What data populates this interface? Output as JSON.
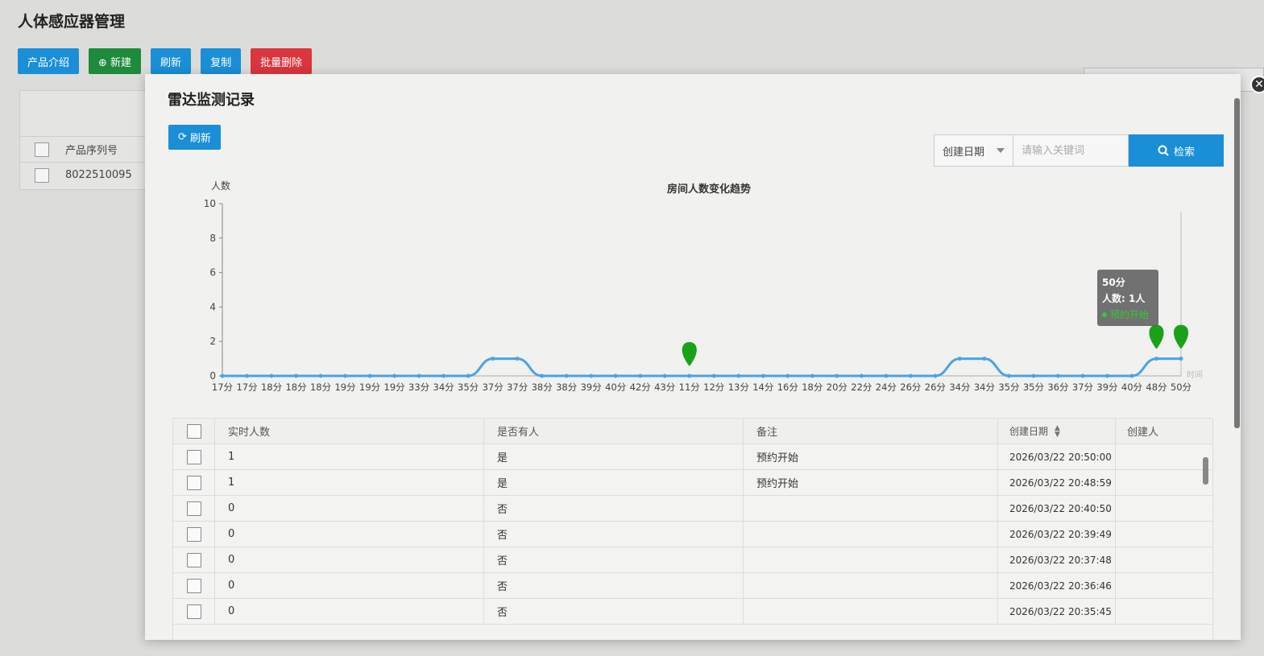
{
  "background": {
    "page_title": "人体感应器管理",
    "toolbar": [
      "产品介绍",
      "⊕ 新建",
      "刷新",
      "复制",
      "批量删除"
    ],
    "table_header": "产品序列号",
    "table_row": "8022510095"
  },
  "modal": {
    "title": "雷达监测记录",
    "close_label": "✕",
    "refresh_label": "刷新",
    "search": {
      "date_label": "创建日期",
      "placeholder": "请输入关键词",
      "button_label": "检索"
    }
  },
  "chart_data": {
    "type": "line",
    "title": "房间人数变化趋势",
    "ylabel": "人数",
    "xlabel": "时间",
    "ylim": [
      0,
      10
    ],
    "yticks": [
      0,
      2,
      4,
      6,
      8,
      10
    ],
    "categories": [
      "17分",
      "17分",
      "18分",
      "18分",
      "18分",
      "19分",
      "19分",
      "19分",
      "33分",
      "34分",
      "35分",
      "37分",
      "37分",
      "38分",
      "38分",
      "39分",
      "40分",
      "42分",
      "43分",
      "11分",
      "12分",
      "13分",
      "14分",
      "16分",
      "18分",
      "20分",
      "22分",
      "24分",
      "26分",
      "26分",
      "34分",
      "34分",
      "35分",
      "35分",
      "36分",
      "37分",
      "39分",
      "40分",
      "48分",
      "50分"
    ],
    "values": [
      0,
      0,
      0,
      0,
      0,
      0,
      0,
      0,
      0,
      0,
      0,
      1,
      1,
      0,
      0,
      0,
      0,
      0,
      0,
      0,
      0,
      0,
      0,
      0,
      0,
      0,
      0,
      0,
      0,
      0,
      1,
      1,
      0,
      0,
      0,
      0,
      0,
      0,
      1,
      1
    ],
    "markers": [
      19,
      38,
      39
    ],
    "tooltip": {
      "time": "50分",
      "line": "人数: 1人",
      "note": "预约开始"
    },
    "colors": {
      "line": "#4aa3e8",
      "marker": "#1aa11a"
    }
  },
  "table": {
    "headers": {
      "count": "实时人数",
      "has_person": "是否有人",
      "note": "备注",
      "date": "创建日期",
      "creator": "创建人"
    },
    "rows": [
      {
        "count": "1",
        "has_person": "是",
        "note": "预约开始",
        "date": "2026/03/22 20:50:00",
        "creator": ""
      },
      {
        "count": "1",
        "has_person": "是",
        "note": "预约开始",
        "date": "2026/03/22 20:48:59",
        "creator": ""
      },
      {
        "count": "0",
        "has_person": "否",
        "note": "",
        "date": "2026/03/22 20:40:50",
        "creator": ""
      },
      {
        "count": "0",
        "has_person": "否",
        "note": "",
        "date": "2026/03/22 20:39:49",
        "creator": ""
      },
      {
        "count": "0",
        "has_person": "否",
        "note": "",
        "date": "2026/03/22 20:37:48",
        "creator": ""
      },
      {
        "count": "0",
        "has_person": "否",
        "note": "",
        "date": "2026/03/22 20:36:46",
        "creator": ""
      },
      {
        "count": "0",
        "has_person": "否",
        "note": "",
        "date": "2026/03/22 20:35:45",
        "creator": ""
      }
    ]
  }
}
